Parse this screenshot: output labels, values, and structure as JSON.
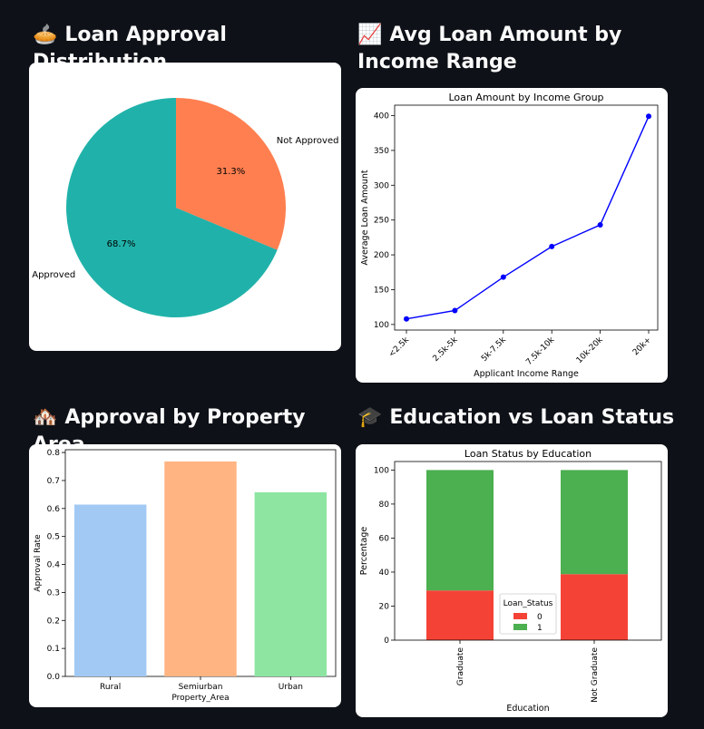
{
  "sections": {
    "pie": {
      "emoji": "🥧",
      "title": "Loan Approval Distribution"
    },
    "line": {
      "emoji": "📈",
      "title": "Avg Loan Amount by Income Range"
    },
    "bar": {
      "emoji": "🏘️",
      "title": "Approval by Property Area"
    },
    "stack": {
      "emoji": "🎓",
      "title": "Education vs Loan Status"
    }
  },
  "chart_data": [
    {
      "id": "pie",
      "type": "pie",
      "labels": [
        "Approved",
        "Not Approved"
      ],
      "values": [
        68.7,
        31.3
      ],
      "pct_labels": [
        "68.7%",
        "31.3%"
      ],
      "colors": [
        "#20b2aa",
        "#ff7f50"
      ]
    },
    {
      "id": "line",
      "type": "line",
      "title": "Loan Amount by Income Group",
      "xlabel": "Applicant Income Range",
      "ylabel": "Average Loan Amount",
      "categories": [
        "<2.5k",
        "2.5k-5k",
        "5k-7.5k",
        "7.5k-10k",
        "10k-20k",
        "20k+"
      ],
      "values": [
        108,
        120,
        168,
        212,
        243,
        399
      ],
      "ylim": [
        92,
        415
      ],
      "yticks": [
        100,
        150,
        200,
        250,
        300,
        350,
        400
      ],
      "color": "#0000ff"
    },
    {
      "id": "bar",
      "type": "bar",
      "xlabel": "Property_Area",
      "ylabel": "Approval Rate",
      "categories": [
        "Rural",
        "Semiurban",
        "Urban"
      ],
      "values": [
        0.614,
        0.768,
        0.658
      ],
      "ylim": [
        0,
        0.81
      ],
      "yticks": [
        "0.0",
        "0.1",
        "0.2",
        "0.3",
        "0.4",
        "0.5",
        "0.6",
        "0.7",
        "0.8"
      ],
      "colors": [
        "#a1c9f4",
        "#ffb482",
        "#8de5a1"
      ]
    },
    {
      "id": "stack",
      "type": "bar",
      "title": "Loan Status by Education",
      "xlabel": "Education",
      "ylabel": "Percentage",
      "categories": [
        "Graduate",
        "Not Graduate"
      ],
      "series": [
        {
          "name": "0",
          "values": [
            29.2,
            38.8
          ],
          "color": "#f44336"
        },
        {
          "name": "1",
          "values": [
            70.8,
            61.2
          ],
          "color": "#4caf50"
        }
      ],
      "legend_title": "Loan_Status",
      "ylim": [
        0,
        105
      ],
      "yticks": [
        0,
        20,
        40,
        60,
        80,
        100
      ]
    }
  ]
}
